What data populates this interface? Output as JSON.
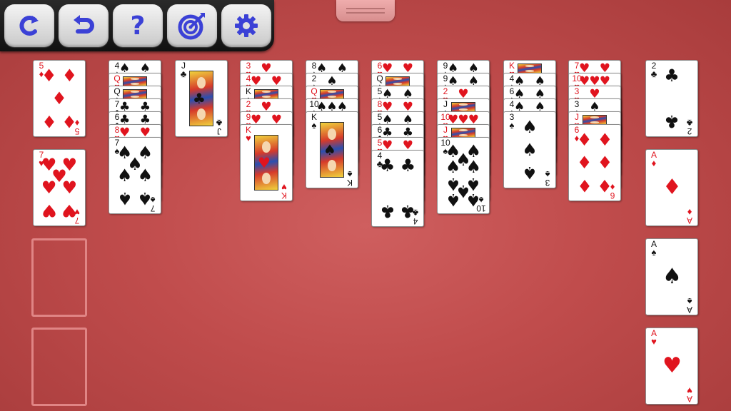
{
  "toolbar": {
    "buttons": [
      {
        "name": "restart-button",
        "icon": "restart-icon"
      },
      {
        "name": "undo-button",
        "icon": "undo-icon"
      },
      {
        "name": "help-button",
        "icon": "help-icon",
        "label": "?"
      },
      {
        "name": "hint-button",
        "icon": "target-icon"
      },
      {
        "name": "settings-button",
        "icon": "gear-icon"
      }
    ]
  },
  "colors": {
    "felt": "#c04c4c",
    "icon_blue": "#3b41d6",
    "red_suit": "#e0141e",
    "black_suit": "#111111",
    "slot_outline": "#e08585"
  },
  "reserve": {
    "cards": [
      {
        "rank": "5",
        "suit": "♦",
        "color": "red"
      },
      {
        "rank": "7",
        "suit": "♥",
        "color": "red"
      }
    ],
    "empty_slots": 2
  },
  "tableau": [
    {
      "column": 1,
      "cards": [
        {
          "rank": "4",
          "suit": "♠",
          "color": "black"
        },
        {
          "rank": "Q",
          "suit": "♥",
          "color": "red"
        },
        {
          "rank": "Q",
          "suit": "♠",
          "color": "black"
        },
        {
          "rank": "7",
          "suit": "♣",
          "color": "black"
        },
        {
          "rank": "6",
          "suit": "♣",
          "color": "black"
        },
        {
          "rank": "8",
          "suit": "♥",
          "color": "red"
        },
        {
          "rank": "7",
          "suit": "♠",
          "color": "black"
        }
      ]
    },
    {
      "column": 2,
      "cards": [
        {
          "rank": "J",
          "suit": "♣",
          "color": "black"
        }
      ]
    },
    {
      "column": 3,
      "cards": [
        {
          "rank": "3",
          "suit": "♥",
          "color": "red"
        },
        {
          "rank": "4",
          "suit": "♥",
          "color": "red"
        },
        {
          "rank": "K",
          "suit": "♠",
          "color": "black"
        },
        {
          "rank": "2",
          "suit": "♥",
          "color": "red"
        },
        {
          "rank": "9",
          "suit": "♥",
          "color": "red"
        },
        {
          "rank": "K",
          "suit": "♥",
          "color": "red"
        }
      ]
    },
    {
      "column": 4,
      "cards": [
        {
          "rank": "8",
          "suit": "♠",
          "color": "black"
        },
        {
          "rank": "2",
          "suit": "♠",
          "color": "black"
        },
        {
          "rank": "Q",
          "suit": "♥",
          "color": "red"
        },
        {
          "rank": "10",
          "suit": "♠",
          "color": "black"
        },
        {
          "rank": "K",
          "suit": "♠",
          "color": "black"
        }
      ]
    },
    {
      "column": 5,
      "cards": [
        {
          "rank": "6",
          "suit": "♥",
          "color": "red"
        },
        {
          "rank": "Q",
          "suit": "♠",
          "color": "black"
        },
        {
          "rank": "5",
          "suit": "♠",
          "color": "black"
        },
        {
          "rank": "8",
          "suit": "♥",
          "color": "red"
        },
        {
          "rank": "5",
          "suit": "♠",
          "color": "black"
        },
        {
          "rank": "6",
          "suit": "♣",
          "color": "black"
        },
        {
          "rank": "5",
          "suit": "♥",
          "color": "red"
        },
        {
          "rank": "4",
          "suit": "♣",
          "color": "black"
        }
      ]
    },
    {
      "column": 6,
      "cards": [
        {
          "rank": "9",
          "suit": "♠",
          "color": "black"
        },
        {
          "rank": "9",
          "suit": "♠",
          "color": "black"
        },
        {
          "rank": "2",
          "suit": "♥",
          "color": "red"
        },
        {
          "rank": "J",
          "suit": "♠",
          "color": "black"
        },
        {
          "rank": "10",
          "suit": "♥",
          "color": "red"
        },
        {
          "rank": "J",
          "suit": "♥",
          "color": "red"
        },
        {
          "rank": "10",
          "suit": "♠",
          "color": "black"
        }
      ]
    },
    {
      "column": 7,
      "cards": [
        {
          "rank": "K",
          "suit": "♥",
          "color": "red"
        },
        {
          "rank": "4",
          "suit": "♠",
          "color": "black"
        },
        {
          "rank": "6",
          "suit": "♠",
          "color": "black"
        },
        {
          "rank": "4",
          "suit": "♠",
          "color": "black"
        },
        {
          "rank": "3",
          "suit": "♠",
          "color": "black"
        }
      ]
    },
    {
      "column": 8,
      "cards": [
        {
          "rank": "7",
          "suit": "♥",
          "color": "red"
        },
        {
          "rank": "10",
          "suit": "♥",
          "color": "red"
        },
        {
          "rank": "3",
          "suit": "♥",
          "color": "red"
        },
        {
          "rank": "3",
          "suit": "♠",
          "color": "black"
        },
        {
          "rank": "J",
          "suit": "♥",
          "color": "red"
        },
        {
          "rank": "6",
          "suit": "♦",
          "color": "red"
        }
      ]
    }
  ],
  "foundations": [
    {
      "rank": "2",
      "suit": "♣",
      "color": "black"
    },
    {
      "rank": "A",
      "suit": "♦",
      "color": "red"
    },
    {
      "rank": "A",
      "suit": "♠",
      "color": "black"
    },
    {
      "rank": "A",
      "suit": "♥",
      "color": "red"
    }
  ]
}
